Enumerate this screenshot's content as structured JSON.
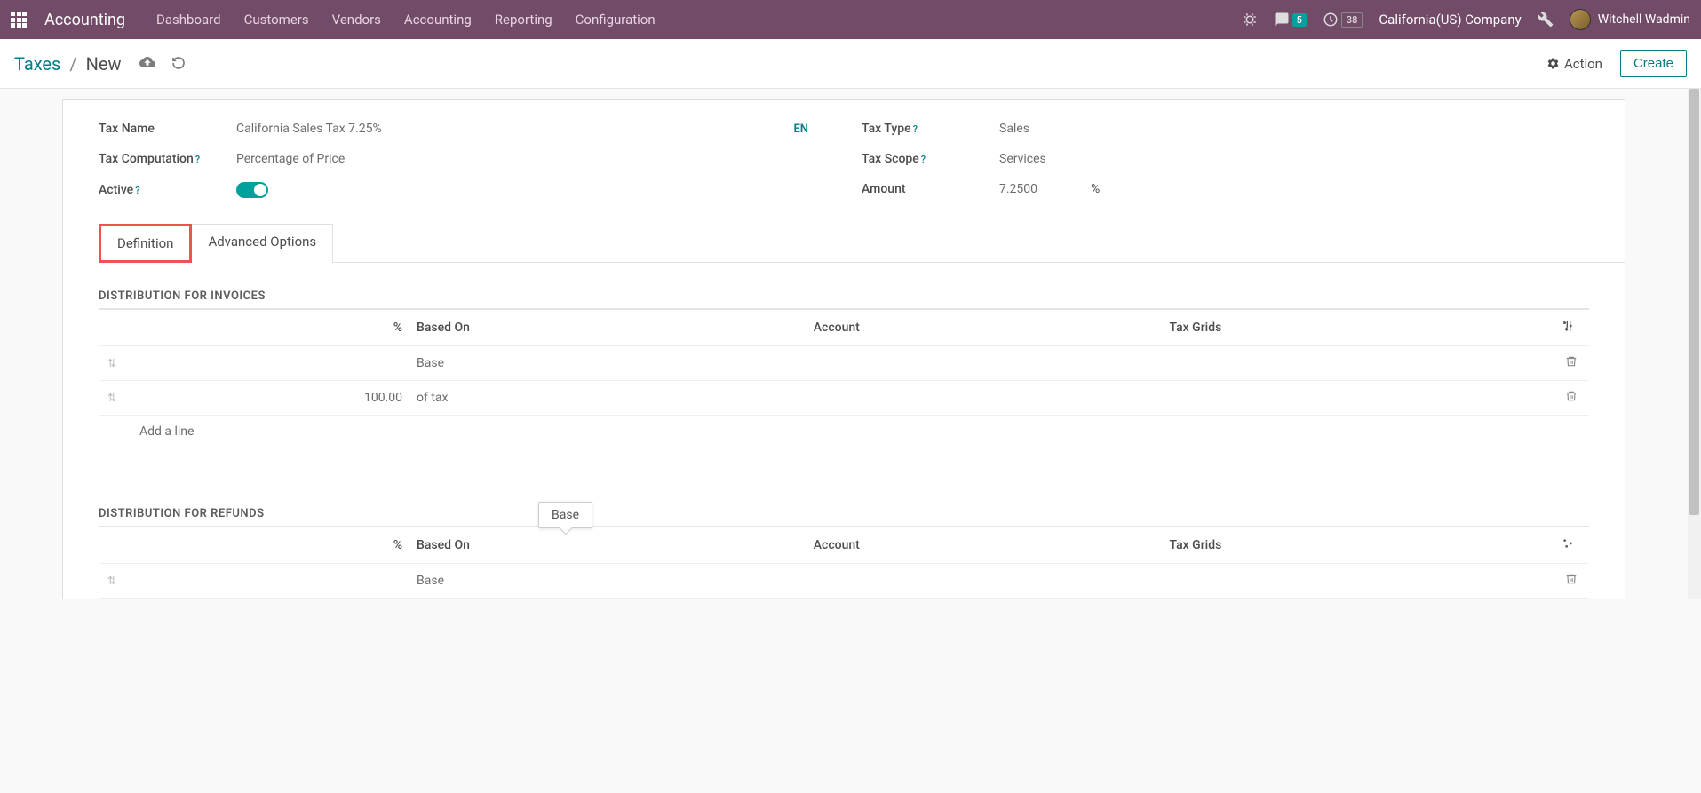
{
  "navbar": {
    "brand": "Accounting",
    "menu": [
      "Dashboard",
      "Customers",
      "Vendors",
      "Accounting",
      "Reporting",
      "Configuration"
    ],
    "messages_count": "5",
    "activities_count": "38",
    "company": "California(US) Company",
    "user": "Witchell Wadmin"
  },
  "breadcrumb": {
    "parent": "Taxes",
    "current": "New"
  },
  "cp": {
    "action_label": "Action",
    "create_label": "Create"
  },
  "fields": {
    "tax_name_label": "Tax Name",
    "tax_name_value": "California Sales Tax 7.25%",
    "lang": "EN",
    "tax_computation_label": "Tax Computation",
    "tax_computation_value": "Percentage of Price",
    "active_label": "Active",
    "tax_type_label": "Tax Type",
    "tax_type_value": "Sales",
    "tax_scope_label": "Tax Scope",
    "tax_scope_value": "Services",
    "amount_label": "Amount",
    "amount_value": "7.2500",
    "amount_suffix": "%"
  },
  "tabs": {
    "definition": "Definition",
    "advanced": "Advanced Options"
  },
  "sections": {
    "invoices_title": "DISTRIBUTION FOR INVOICES",
    "refunds_title": "DISTRIBUTION FOR REFUNDS"
  },
  "table": {
    "headers": {
      "percent": "%",
      "based_on": "Based On",
      "account": "Account",
      "tax_grids": "Tax Grids"
    },
    "invoice_rows": [
      {
        "percent": "",
        "based_on": "Base",
        "account": "",
        "tax_grids": ""
      },
      {
        "percent": "100.00",
        "based_on": "of tax",
        "account": "",
        "tax_grids": ""
      }
    ],
    "refund_rows": [
      {
        "percent": "",
        "based_on": "Base",
        "account": "",
        "tax_grids": ""
      }
    ],
    "add_line": "Add a line"
  },
  "tooltip": {
    "text": "Base"
  }
}
